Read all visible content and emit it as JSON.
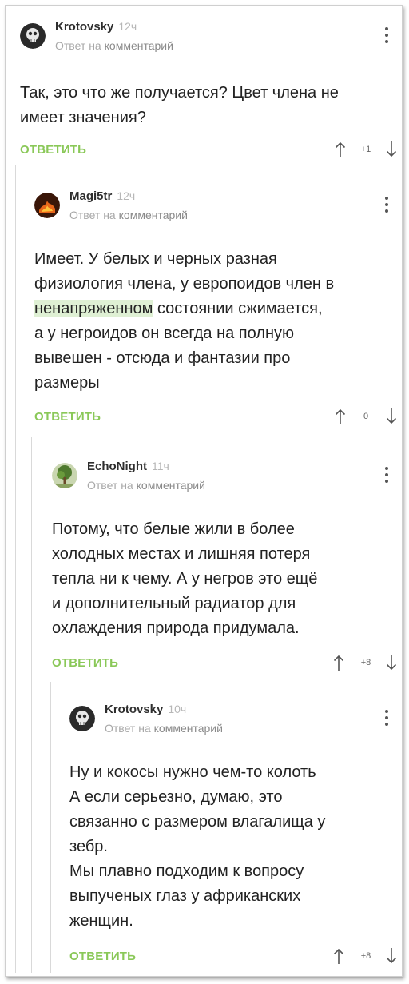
{
  "colors": {
    "accent_green": "#8ac858",
    "highlight_green": "#dff0d4",
    "muted_text": "#a8a8a8",
    "thread_line": "#d9d9d9"
  },
  "comments": [
    {
      "author": "Krotovsky",
      "age": "12ч",
      "reply_prefix": "Ответ на",
      "reply_target": "комментарий",
      "avatar_icon": "skull-avatar-icon",
      "text_lines": [
        "Так, это что же получается? Цвет члена не",
        "имеет значения?"
      ],
      "reply_label": "ОТВЕТИТЬ",
      "rating": "+1"
    },
    {
      "author": "Magi5tr",
      "age": "12ч",
      "reply_prefix": "Ответ на",
      "reply_target": "комментарий",
      "avatar_icon": "fire-avatar-icon",
      "text_lines": [
        "Имеет. У белых и черных разная",
        "физиология члена, у европоидов член в",
        "ненапряженном",
        "состоянии сжимается,",
        "а у негроидов он всегда на полную",
        "вывешен - отсюда и фантазии про",
        "размеры"
      ],
      "reply_label": "ОТВЕТИТЬ",
      "rating": "0"
    },
    {
      "author": "EchoNight",
      "age": "11ч",
      "reply_prefix": "Ответ на",
      "reply_target": "комментарий",
      "avatar_icon": "tree-avatar-icon",
      "text_lines": [
        "Потому, что белые жили в более",
        "холодных местах и лишняя потеря",
        "тепла ни к чему. А у негров это ещё",
        "и дополнительный радиатор для",
        "охлаждения природа придумала."
      ],
      "reply_label": "ОТВЕТИТЬ",
      "rating": "+8"
    },
    {
      "author": "Krotovsky",
      "age": "10ч",
      "reply_prefix": "Ответ на",
      "reply_target": "комментарий",
      "avatar_icon": "skull-avatar-icon",
      "text_lines": [
        "Ну и кокосы нужно чем-то колоть",
        "А если серьезно, думаю, это",
        "связанно с размером влагалища у",
        "зебр.",
        "Мы плавно подходим к вопросу",
        "выпученых глаз у африканских",
        "женщин."
      ],
      "reply_label": "ОТВЕТИТЬ",
      "rating": "+8"
    }
  ]
}
